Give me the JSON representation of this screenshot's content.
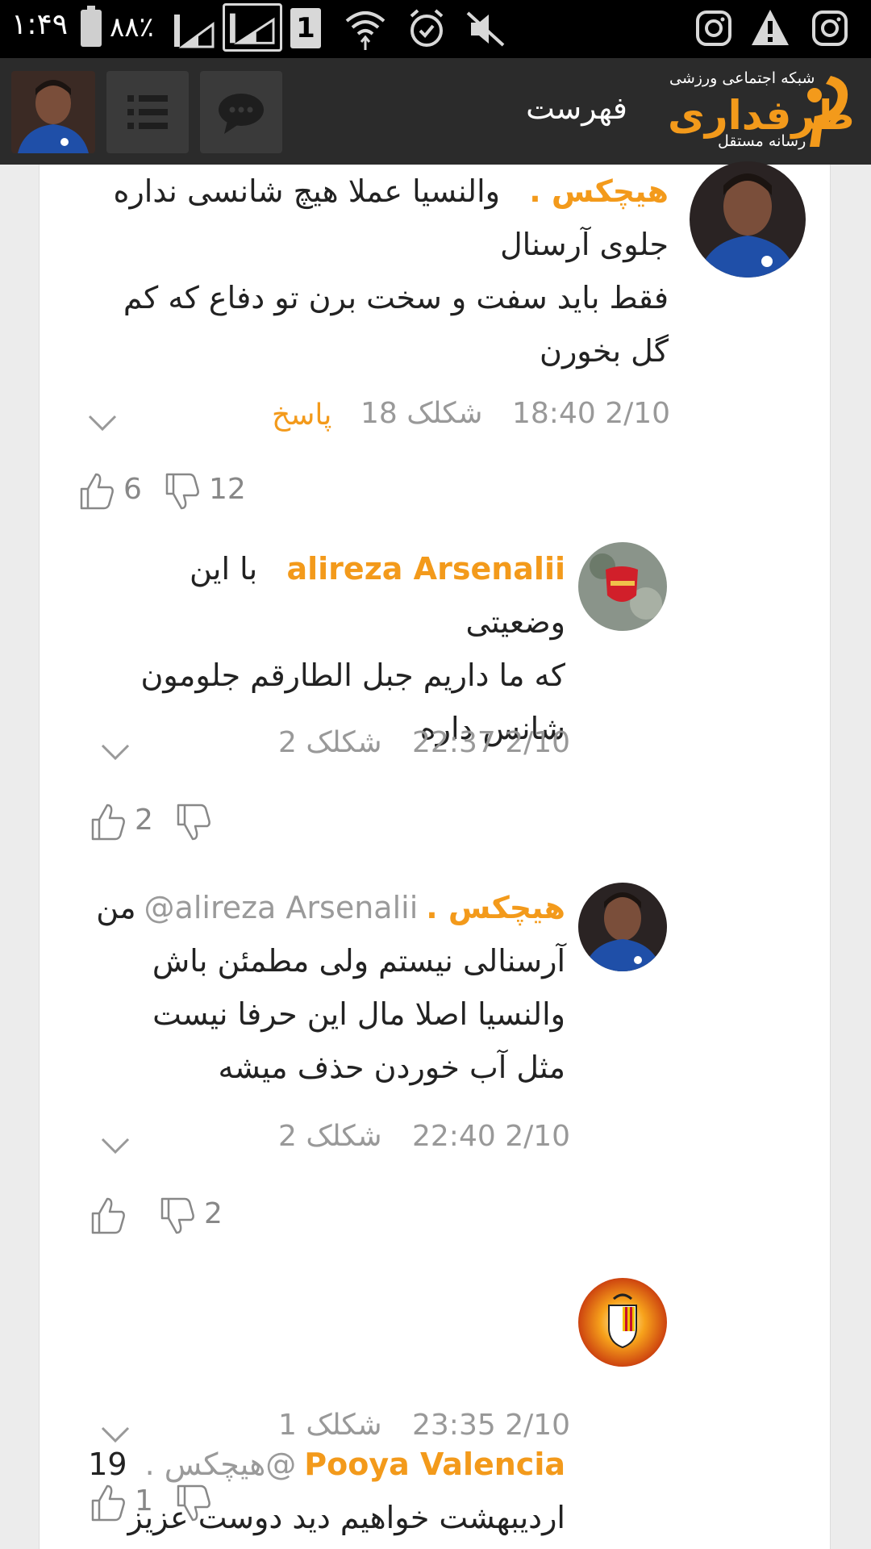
{
  "status_bar": {
    "time": "۱:۴۹",
    "battery": "۸۸٪",
    "sim_label": "1",
    "icons": [
      "battery-icon",
      "signal-icon",
      "signal-icon",
      "sim-icon",
      "wifi-icon",
      "alarm-icon",
      "mute-icon",
      "instagram-icon",
      "warning-icon",
      "instagram-icon"
    ]
  },
  "header": {
    "menu_title": "فهرست",
    "logo_name": "طرفداری",
    "logo_tagline_top": "شبکه اجتماعی ورزشی",
    "logo_tagline_bottom": "رسانه مستقل",
    "accent_color": "#f39a1b",
    "background": "#2b2b2b"
  },
  "comments": [
    {
      "author": "هیچکس .",
      "mention": "",
      "text_lines": [
        "والنسیا عملا هیچ شانسی نداره",
        "جلوی آرسنال",
        "فقط باید سفت و سخت برن تو دفاع که کم",
        "گل بخورن"
      ],
      "date": "2/10",
      "time": "18:40",
      "shekalak": "18 شکلک",
      "reply_label": "پاسخ",
      "likes": "6",
      "dislikes": "12"
    },
    {
      "author": "alireza Arsenalii",
      "mention": "",
      "text_lines": [
        "با این وضعیتی",
        "که ما داریم جبل الطارقم جلومون",
        "شانس داره"
      ],
      "date": "2/10",
      "time": "22:37",
      "shekalak": "2 شکلک",
      "likes": "2",
      "dislikes": ""
    },
    {
      "author": "هیچکس .",
      "mention": "alireza Arsenalii@",
      "text_lines": [
        "من",
        "آرسنالی نیستم ولی مطمئن باش",
        "والنسیا اصلا مال این حرفا نیست",
        "مثل آب خوردن حذف میشه"
      ],
      "date": "2/10",
      "time": "22:40",
      "shekalak": "2 شکلک",
      "likes": "",
      "dislikes": "2"
    },
    {
      "author": "Pooya Valencia",
      "mention": "@هیچکس .",
      "text_lines": [
        "19",
        "اردیبهشت خواهیم دید دوست عزیز"
      ],
      "date": "2/10",
      "time": "23:35",
      "shekalak": "1 شکلک",
      "likes": "1",
      "dislikes": ""
    }
  ]
}
